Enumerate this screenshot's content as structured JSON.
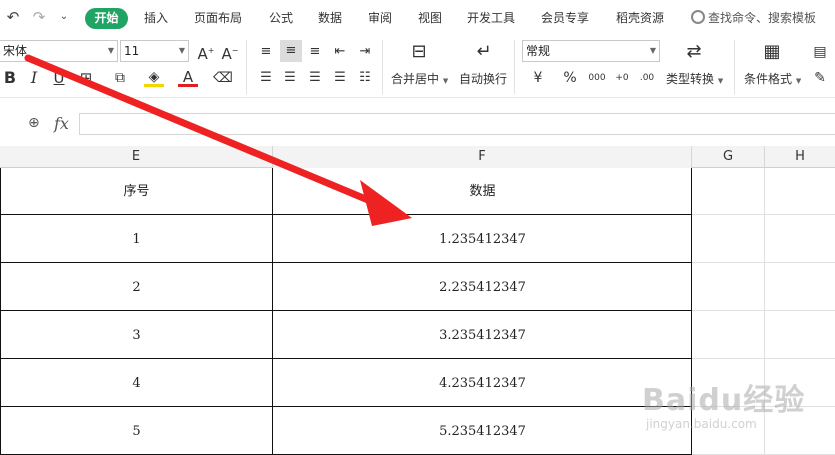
{
  "quick_access": {
    "undo_icon": "undo-icon",
    "redo_icon": "redo-icon",
    "more_icon": "chevron-down-icon"
  },
  "menu": {
    "tabs": [
      "开始",
      "插入",
      "页面布局",
      "公式",
      "数据",
      "审阅",
      "视图",
      "开发工具",
      "会员专享",
      "稻壳资源"
    ],
    "active_tab": "开始",
    "search_text": "查找命令、搜索模板",
    "accent_color": "#1fa463"
  },
  "ribbon": {
    "font_name": "宋体",
    "font_size": "11",
    "number_format": "常规",
    "bold_label": "B",
    "italic_label": "I",
    "underline_label": "U",
    "font_color_label": "A",
    "merge_center_label": "合并居中",
    "wrap_text_label": "自动换行",
    "currency_label": "¥",
    "percent_label": "%",
    "thousands_label": "000",
    "increase_decimal_label": "+0",
    "decrease_decimal_label": ".00",
    "type_convert_label": "类型转换",
    "conditional_format_label": "条件格式"
  },
  "formula_bar": {
    "fx_label": "fx",
    "value": ""
  },
  "sheet": {
    "columns": [
      "E",
      "F",
      "G",
      "H"
    ],
    "header_row": [
      "序号",
      "数据"
    ],
    "rows": [
      [
        "1",
        "1.235412347"
      ],
      [
        "2",
        "2.235412347"
      ],
      [
        "3",
        "3.235412347"
      ],
      [
        "4",
        "4.235412347"
      ],
      [
        "5",
        "5.235412347"
      ]
    ]
  },
  "annotation": {
    "arrow_color": "#ee2222"
  },
  "watermark": {
    "brand": "Baidu经验",
    "url": "jingyan.baidu.com"
  }
}
